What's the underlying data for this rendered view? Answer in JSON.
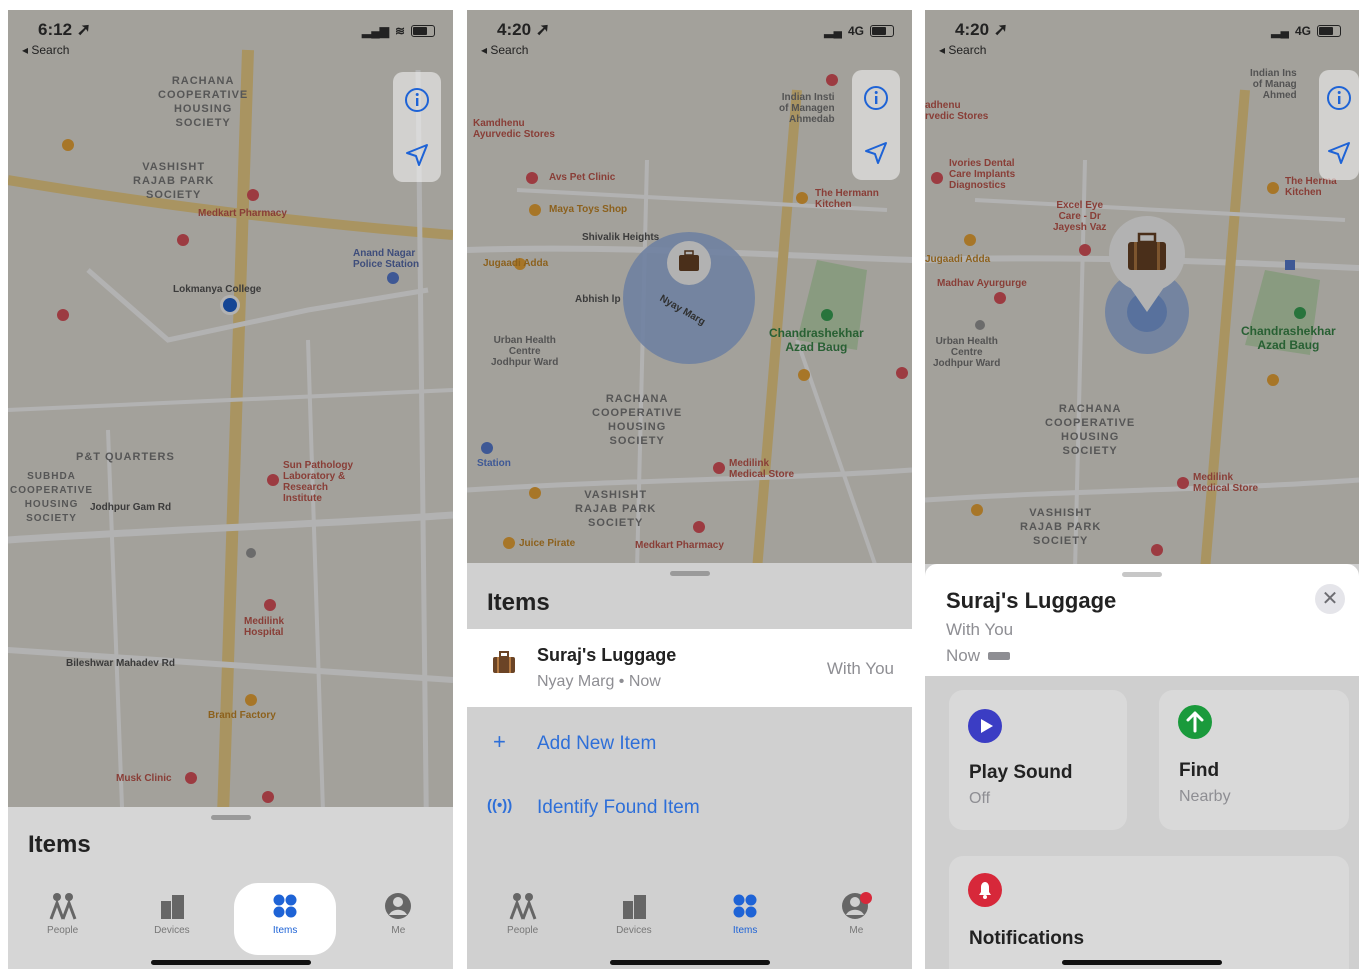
{
  "screen1": {
    "status": {
      "time": "6:12 ➚",
      "back": "◂ Search"
    },
    "map_labels": {
      "rachana": "RACHANA\nCOOPERATIVE\nHOUSING\nSOCIETY",
      "vashisht": "VASHISHT\nRAJAB PARK\nSOCIETY",
      "pat_quarters": "P&T QUARTERS",
      "subhda": "SUBHDA\nCOOPERATIVE\nHOUSING\nSOCIETY",
      "road1": "Jodhpur Gam Rd",
      "road2": "Bileshwar Mahadev Rd",
      "college": "Lokmanya College",
      "medkart": "Medkart Pharmacy",
      "police": "Anand Nagar\nPolice Station",
      "sun": "Sun Pathology\nLaboratory &\nResearch\nInstitute",
      "medilink": "Medilink\nHospital",
      "brand": "Brand Factory",
      "musk": "Musk Clinic"
    },
    "sheet_title": "Items",
    "tabs": [
      {
        "label": "People",
        "icon": "people-icon"
      },
      {
        "label": "Devices",
        "icon": "devices-icon"
      },
      {
        "label": "Items",
        "icon": "items-icon"
      },
      {
        "label": "Me",
        "icon": "me-icon"
      }
    ]
  },
  "screen2": {
    "status": {
      "time": "4:20 ➚",
      "back": "◂ Search",
      "network": "4G"
    },
    "map_labels": {
      "kamdhenu": "Kamdhenu\nAyurvedic Stores",
      "avs": "Avs Pet Clinic",
      "maya": "Maya Toys Shop",
      "shivalik": "Shivalik Heights",
      "jugaadi": "Jugaadi Adda",
      "abhish": "Abhish lp",
      "nyay": "Nyay Marg",
      "urban": "Urban Health\nCentre\nJodhpur Ward",
      "chandra": "Chandrashekhar\nAzad Baug",
      "rachana": "RACHANA\nCOOPERATIVE\nHOUSING\nSOCIETY",
      "vashisht": "VASHISHT\nRAJAB PARK\nSOCIETY",
      "medilink": "Medilink\nMedical Store",
      "medkart": "Medkart Pharmacy",
      "juice": "Juice Pirate",
      "station": "Station",
      "indian": "Indian Insti\nof Managen\nAhmedab",
      "hermann": "The Hermann\nKitchen"
    },
    "sheet_title": "Items",
    "item": {
      "name": "Suraj's Luggage",
      "location": "Nyay Marg • Now",
      "status": "With You"
    },
    "actions": [
      {
        "label": "Add New Item",
        "icon": "plus-icon"
      },
      {
        "label": "Identify Found Item",
        "icon": "nfc-icon"
      }
    ],
    "tabs": [
      {
        "label": "People"
      },
      {
        "label": "Devices"
      },
      {
        "label": "Items"
      },
      {
        "label": "Me"
      }
    ]
  },
  "screen3": {
    "status": {
      "time": "4:20 ➚",
      "back": "◂ Search",
      "network": "4G"
    },
    "map_labels": {
      "vedhenu": "adhenu\nrvedic Stores",
      "ivories": "Ivories Dental\nCare Implants\nDiagnostics",
      "excel": "Excel Eye\nCare - Dr\nJayesh Vaz",
      "jugaadi": "Jugaadi Adda",
      "madhav": "Madhav Ayurgurge",
      "urban": "Urban Health\nCentre\nJodhpur Ward",
      "chandra": "Chandrashekhar\nAzad Baug",
      "rachana": "RACHANA\nCOOPERATIVE\nHOUSING\nSOCIETY",
      "vashisht": "VASHISHT\nRAJAB PARK\nSOCIETY",
      "medilink": "Medilink\nMedical Store",
      "indian": "Indian Ins\nof Manag\nAhmed",
      "hermann": "The Herma\nKitchen"
    },
    "detail": {
      "title": "Suraj's Luggage",
      "status": "With You",
      "time": "Now"
    },
    "cards": [
      {
        "title": "Play Sound",
        "sub": "Off",
        "icon": "play-icon"
      },
      {
        "title": "Find",
        "sub": "Nearby",
        "icon": "arrow-up-icon"
      }
    ],
    "notifications": {
      "title": "Notifications",
      "icon": "bell-icon"
    }
  },
  "colors": {
    "blue": "#1e63d6",
    "green": "#1a9a3c",
    "red": "#d7283a",
    "purple": "#3b3dc4"
  }
}
